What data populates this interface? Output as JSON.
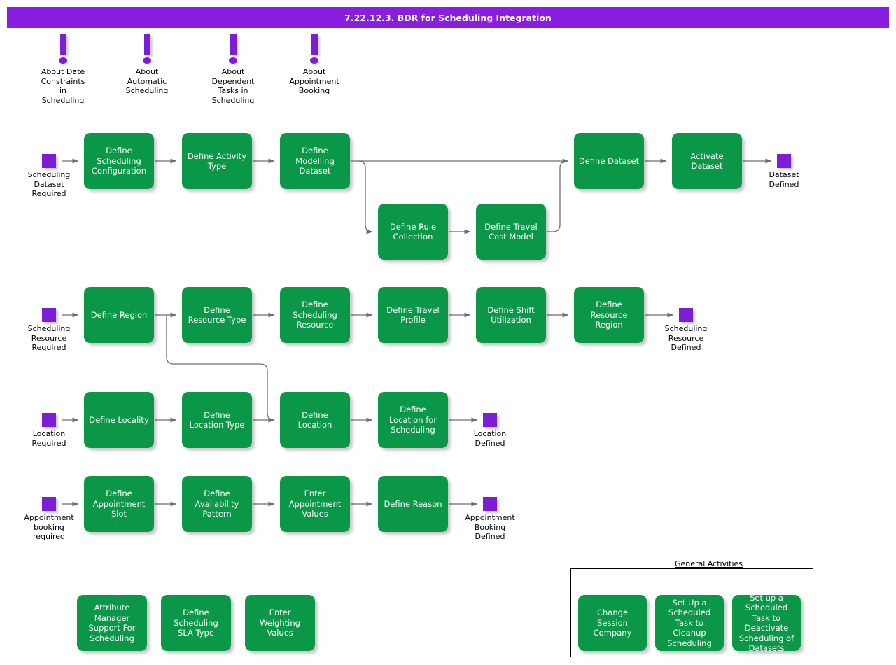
{
  "header": {
    "title": "7.22.12.3. BDR for Scheduling Integration"
  },
  "notes": [
    {
      "id": "note-date-constraints",
      "label": "About Date\nConstraints\nin\nScheduling",
      "icon": "exclamation-icon"
    },
    {
      "id": "note-automatic-scheduling",
      "label": "About\nAutomatic\nScheduling",
      "icon": "exclamation-icon"
    },
    {
      "id": "note-dependent-tasks",
      "label": "About\nDependent\nTasks in\nScheduling",
      "icon": "exclamation-icon"
    },
    {
      "id": "note-appointment-booking",
      "label": "About\nAppointment\nBooking",
      "icon": "exclamation-icon"
    }
  ],
  "lanes": [
    {
      "id": "lane-scheduling-dataset",
      "start": {
        "id": "scheduling-dataset-required",
        "label": "Scheduling\nDataset\nRequired"
      },
      "end": {
        "id": "dataset-defined",
        "label": "Dataset\nDefined"
      },
      "steps": [
        "Define Scheduling Configuration",
        "Define Activity Type",
        "Define Modelling Dataset",
        "Define Dataset",
        "Activate Dataset"
      ],
      "branch": [
        "Define Rule Collection",
        "Define Travel Cost Model"
      ]
    },
    {
      "id": "lane-scheduling-resource",
      "start": {
        "id": "scheduling-resource-required",
        "label": "Scheduling\nResource\nRequired"
      },
      "end": {
        "id": "scheduling-resource-defined",
        "label": "Scheduling\nResource\nDefined"
      },
      "steps": [
        "Define Region",
        "Define Resource Type",
        "Define Scheduling Resource",
        "Define Travel Profile",
        "Define Shift Utilization",
        "Define Resource Region"
      ]
    },
    {
      "id": "lane-location",
      "start": {
        "id": "location-required",
        "label": "Location\nRequired"
      },
      "end": {
        "id": "location-defined",
        "label": "Location\nDefined"
      },
      "steps": [
        "Define Locality",
        "Define Location Type",
        "Define Location",
        "Define Location for Scheduling"
      ]
    },
    {
      "id": "lane-appointment-booking",
      "start": {
        "id": "appointment-booking-required",
        "label": "Appointment\nbooking\nrequired"
      },
      "end": {
        "id": "appointment-booking-defined",
        "label": "Appointment\nBooking\nDefined"
      },
      "steps": [
        "Define Appointment Slot",
        "Define Availability Pattern",
        "Enter Appointment Values",
        "Define Reason"
      ]
    }
  ],
  "standalone": [
    "Attribute Manager Support For Scheduling",
    "Define Scheduling SLA Type",
    "Enter Weighting Values"
  ],
  "general_activities": {
    "title": "General Activities",
    "items": [
      "Change Session Company",
      "Set Up a Scheduled Task to Cleanup Scheduling",
      "Set up a Scheduled Task to Deactivate Scheduling of Datasets"
    ]
  },
  "colors": {
    "title_bar": "#8a1ee0",
    "activity": "#0b9748",
    "terminator": "#7c1fd4",
    "connector": "#6e6e6e",
    "text_on_activity": "#ffffff"
  }
}
